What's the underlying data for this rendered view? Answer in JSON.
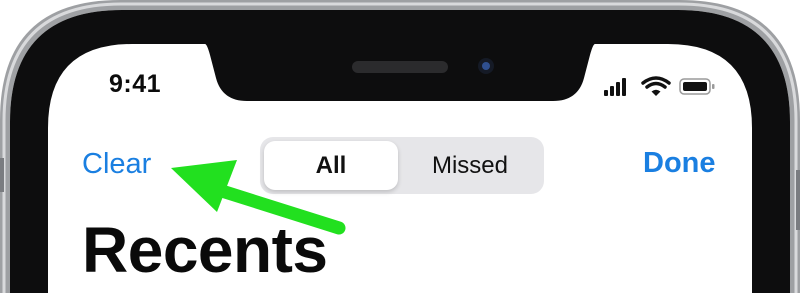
{
  "status_bar": {
    "time": "9:41",
    "icons": [
      "cellular-signal-icon",
      "wifi-icon",
      "battery-icon"
    ]
  },
  "nav": {
    "left_action": "Clear",
    "right_action": "Done",
    "accent_color": "#1a7fe1"
  },
  "segmented_control": {
    "options": [
      "All",
      "Missed"
    ],
    "selected": "All"
  },
  "page": {
    "title": "Recents"
  },
  "annotation": {
    "arrow_color": "#22e01f",
    "points_to": "Clear"
  }
}
